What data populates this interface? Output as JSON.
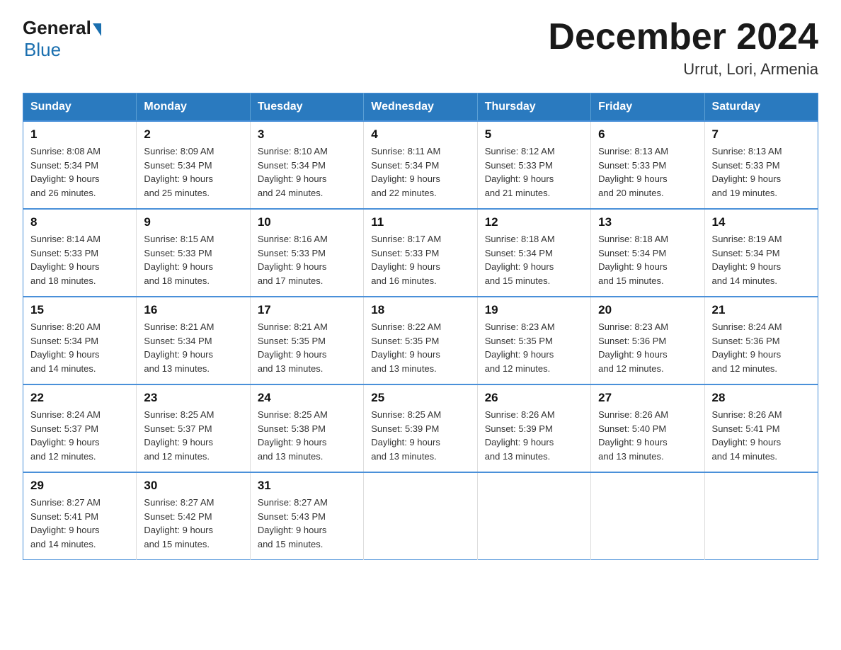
{
  "logo": {
    "general": "General",
    "blue": "Blue"
  },
  "title": "December 2024",
  "location": "Urrut, Lori, Armenia",
  "days_of_week": [
    "Sunday",
    "Monday",
    "Tuesday",
    "Wednesday",
    "Thursday",
    "Friday",
    "Saturday"
  ],
  "weeks": [
    [
      {
        "day": "1",
        "sunrise": "8:08 AM",
        "sunset": "5:34 PM",
        "daylight": "9 hours and 26 minutes."
      },
      {
        "day": "2",
        "sunrise": "8:09 AM",
        "sunset": "5:34 PM",
        "daylight": "9 hours and 25 minutes."
      },
      {
        "day": "3",
        "sunrise": "8:10 AM",
        "sunset": "5:34 PM",
        "daylight": "9 hours and 24 minutes."
      },
      {
        "day": "4",
        "sunrise": "8:11 AM",
        "sunset": "5:34 PM",
        "daylight": "9 hours and 22 minutes."
      },
      {
        "day": "5",
        "sunrise": "8:12 AM",
        "sunset": "5:33 PM",
        "daylight": "9 hours and 21 minutes."
      },
      {
        "day": "6",
        "sunrise": "8:13 AM",
        "sunset": "5:33 PM",
        "daylight": "9 hours and 20 minutes."
      },
      {
        "day": "7",
        "sunrise": "8:13 AM",
        "sunset": "5:33 PM",
        "daylight": "9 hours and 19 minutes."
      }
    ],
    [
      {
        "day": "8",
        "sunrise": "8:14 AM",
        "sunset": "5:33 PM",
        "daylight": "9 hours and 18 minutes."
      },
      {
        "day": "9",
        "sunrise": "8:15 AM",
        "sunset": "5:33 PM",
        "daylight": "9 hours and 18 minutes."
      },
      {
        "day": "10",
        "sunrise": "8:16 AM",
        "sunset": "5:33 PM",
        "daylight": "9 hours and 17 minutes."
      },
      {
        "day": "11",
        "sunrise": "8:17 AM",
        "sunset": "5:33 PM",
        "daylight": "9 hours and 16 minutes."
      },
      {
        "day": "12",
        "sunrise": "8:18 AM",
        "sunset": "5:34 PM",
        "daylight": "9 hours and 15 minutes."
      },
      {
        "day": "13",
        "sunrise": "8:18 AM",
        "sunset": "5:34 PM",
        "daylight": "9 hours and 15 minutes."
      },
      {
        "day": "14",
        "sunrise": "8:19 AM",
        "sunset": "5:34 PM",
        "daylight": "9 hours and 14 minutes."
      }
    ],
    [
      {
        "day": "15",
        "sunrise": "8:20 AM",
        "sunset": "5:34 PM",
        "daylight": "9 hours and 14 minutes."
      },
      {
        "day": "16",
        "sunrise": "8:21 AM",
        "sunset": "5:34 PM",
        "daylight": "9 hours and 13 minutes."
      },
      {
        "day": "17",
        "sunrise": "8:21 AM",
        "sunset": "5:35 PM",
        "daylight": "9 hours and 13 minutes."
      },
      {
        "day": "18",
        "sunrise": "8:22 AM",
        "sunset": "5:35 PM",
        "daylight": "9 hours and 13 minutes."
      },
      {
        "day": "19",
        "sunrise": "8:23 AM",
        "sunset": "5:35 PM",
        "daylight": "9 hours and 12 minutes."
      },
      {
        "day": "20",
        "sunrise": "8:23 AM",
        "sunset": "5:36 PM",
        "daylight": "9 hours and 12 minutes."
      },
      {
        "day": "21",
        "sunrise": "8:24 AM",
        "sunset": "5:36 PM",
        "daylight": "9 hours and 12 minutes."
      }
    ],
    [
      {
        "day": "22",
        "sunrise": "8:24 AM",
        "sunset": "5:37 PM",
        "daylight": "9 hours and 12 minutes."
      },
      {
        "day": "23",
        "sunrise": "8:25 AM",
        "sunset": "5:37 PM",
        "daylight": "9 hours and 12 minutes."
      },
      {
        "day": "24",
        "sunrise": "8:25 AM",
        "sunset": "5:38 PM",
        "daylight": "9 hours and 13 minutes."
      },
      {
        "day": "25",
        "sunrise": "8:25 AM",
        "sunset": "5:39 PM",
        "daylight": "9 hours and 13 minutes."
      },
      {
        "day": "26",
        "sunrise": "8:26 AM",
        "sunset": "5:39 PM",
        "daylight": "9 hours and 13 minutes."
      },
      {
        "day": "27",
        "sunrise": "8:26 AM",
        "sunset": "5:40 PM",
        "daylight": "9 hours and 13 minutes."
      },
      {
        "day": "28",
        "sunrise": "8:26 AM",
        "sunset": "5:41 PM",
        "daylight": "9 hours and 14 minutes."
      }
    ],
    [
      {
        "day": "29",
        "sunrise": "8:27 AM",
        "sunset": "5:41 PM",
        "daylight": "9 hours and 14 minutes."
      },
      {
        "day": "30",
        "sunrise": "8:27 AM",
        "sunset": "5:42 PM",
        "daylight": "9 hours and 15 minutes."
      },
      {
        "day": "31",
        "sunrise": "8:27 AM",
        "sunset": "5:43 PM",
        "daylight": "9 hours and 15 minutes."
      },
      null,
      null,
      null,
      null
    ]
  ],
  "labels": {
    "sunrise": "Sunrise:",
    "sunset": "Sunset:",
    "daylight": "Daylight:"
  }
}
